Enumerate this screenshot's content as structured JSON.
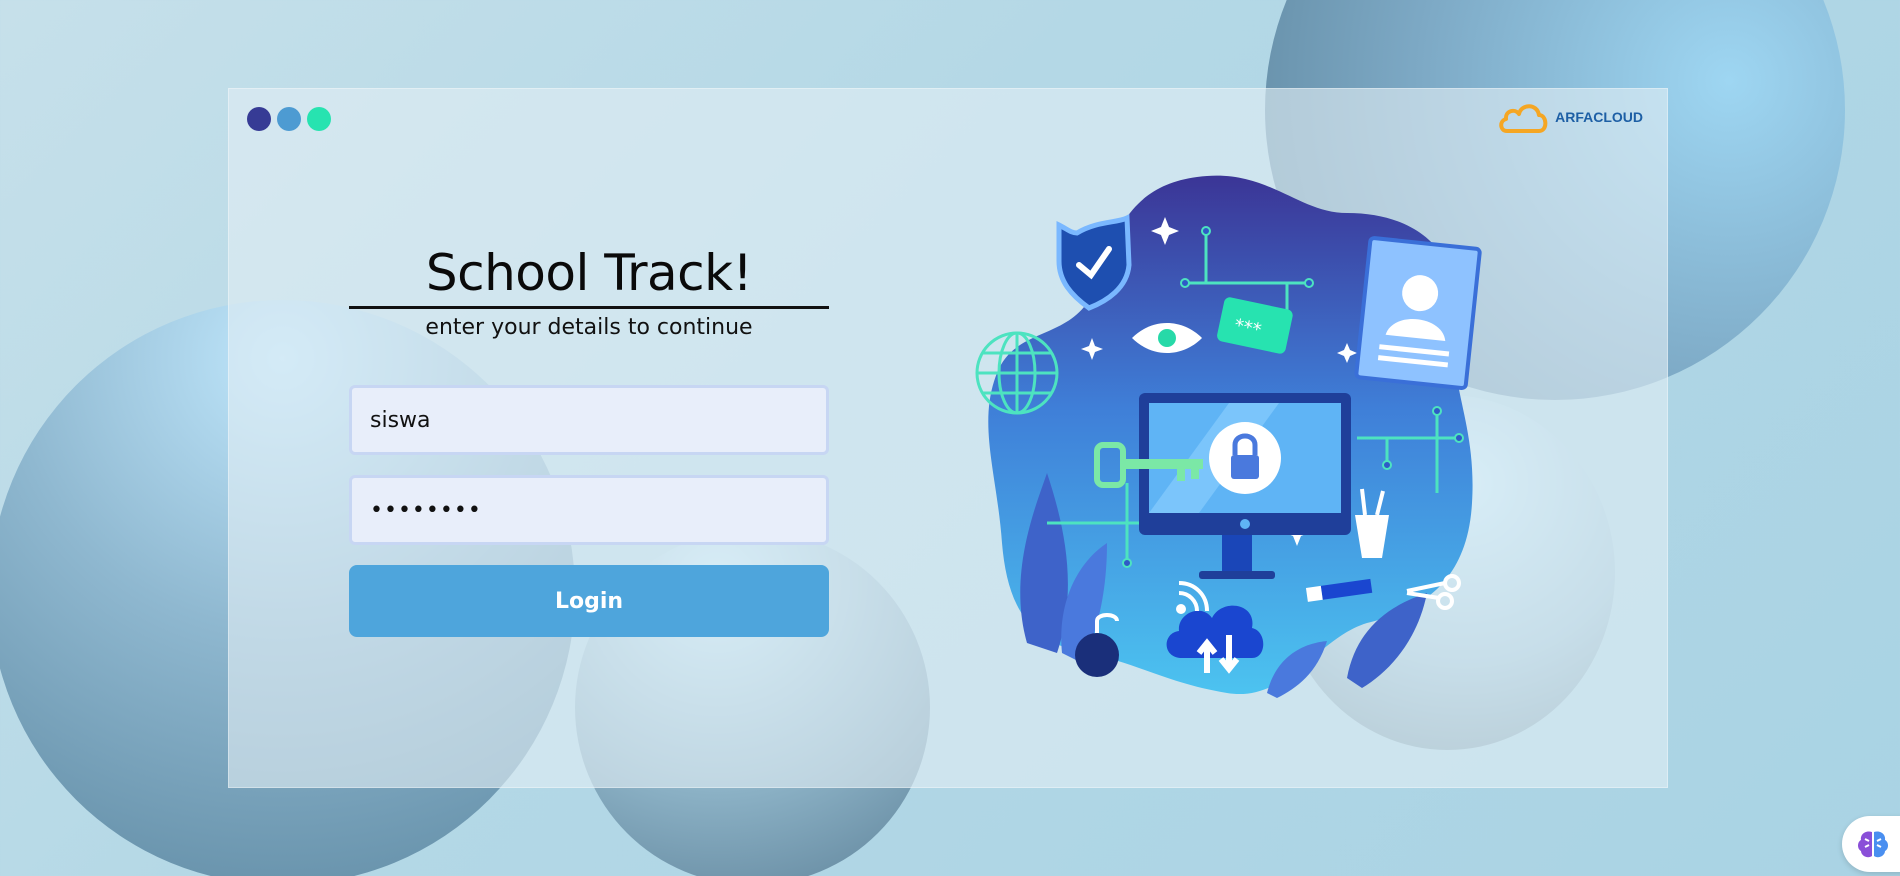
{
  "app": {
    "brand_name": "ARFACLOUD",
    "title": "School Track!",
    "subtitle": "enter your details to continue"
  },
  "form": {
    "username_value": "siswa",
    "password_value": "••••••••",
    "login_label": "Login"
  },
  "colors": {
    "window_dot_1": "#363b95",
    "window_dot_2": "#4d9bd2",
    "window_dot_3": "#27e3b0",
    "button": "#4ea5dc",
    "brand_orange": "#f5a623",
    "brand_blue": "#1d5fa5"
  },
  "icons": {
    "brand_logo": "cloud-logo-icon",
    "illustration": "cyber-security-illustration",
    "assistant": "brain-assistant-icon"
  }
}
